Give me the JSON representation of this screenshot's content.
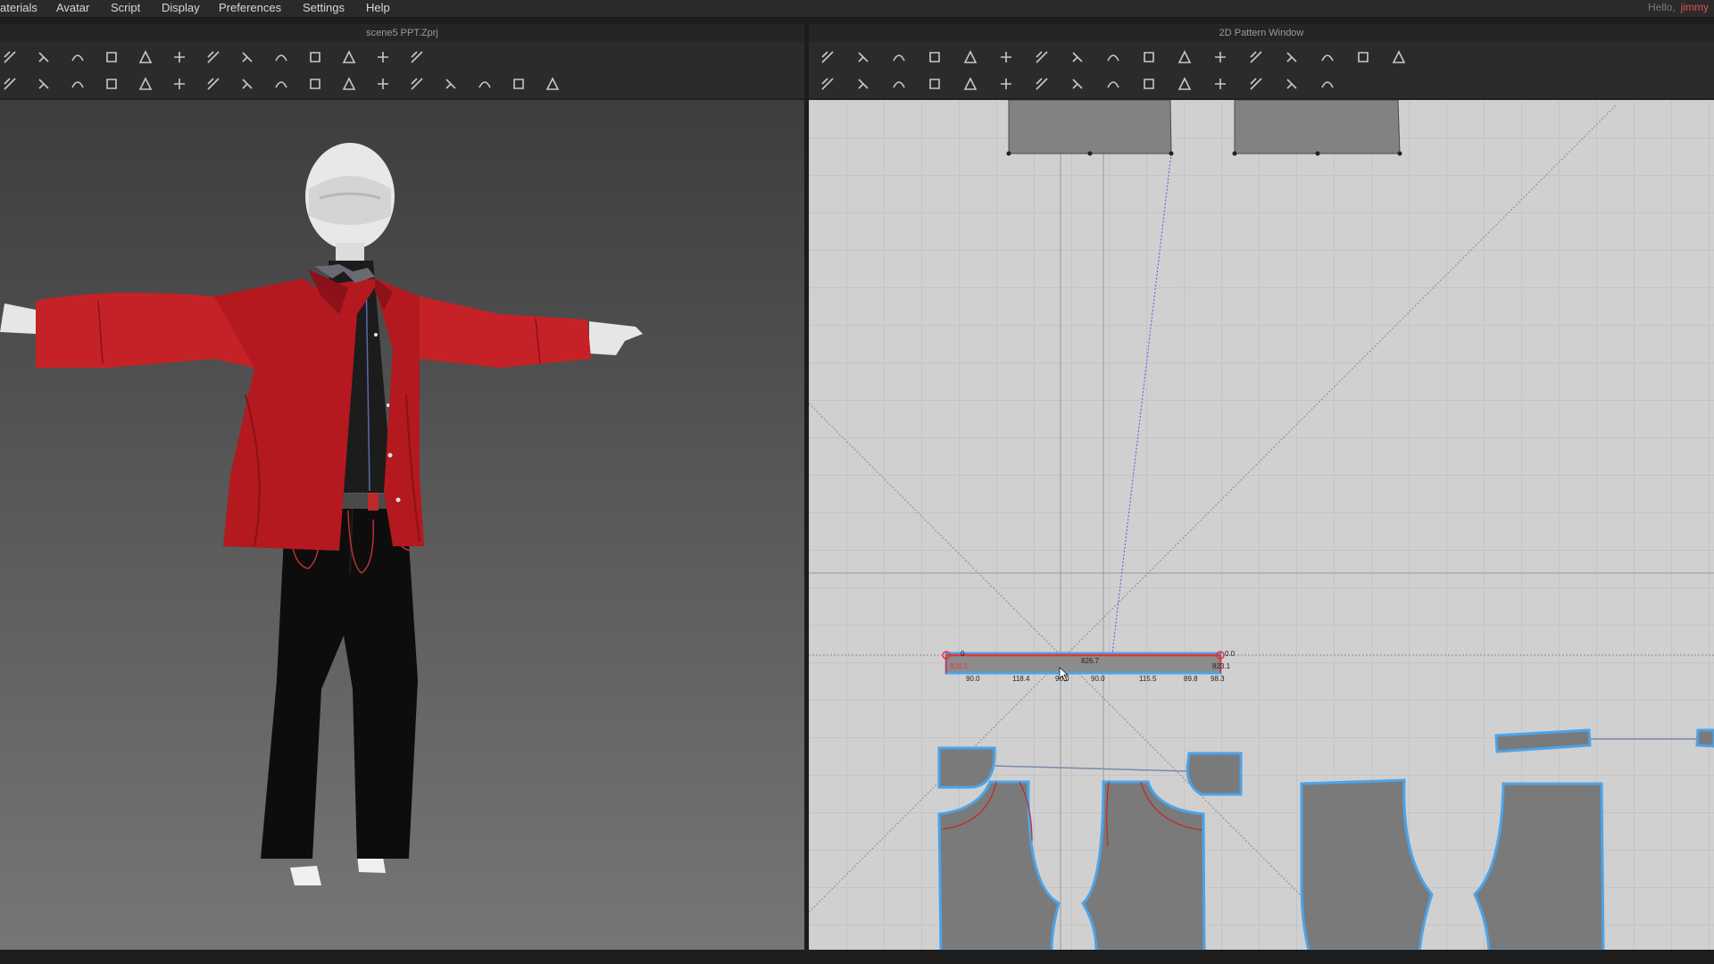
{
  "menu": {
    "items": [
      "aterials",
      "Avatar",
      "Script",
      "Display",
      "Preferences",
      "Settings",
      "Help"
    ],
    "greeting": "Hello,",
    "user": "jimmy"
  },
  "view3d": {
    "title": "scene5 PPT.Zprj",
    "toolbar_row1": [
      "sim-icon",
      "select-icon",
      "move-icon",
      "fold-icon",
      "garment-icon",
      "tack-icon",
      "pin-icon",
      "shirt-icon",
      "avatar-icon",
      "pants-icon",
      "measure-icon",
      "lasso-icon",
      "ruler-icon"
    ],
    "toolbar_row2": [
      "transform-icon",
      "stretch-icon",
      "fabric-icon",
      "steam-icon",
      "button-icon",
      "zipper-icon",
      "point-icon",
      "circle-icon",
      "line-icon",
      "lock-icon",
      "layer-icon",
      "flat-icon",
      "iron-icon",
      "tape-icon",
      "shirt-solid-icon",
      "shirt-outline-icon",
      "puckering-icon"
    ]
  },
  "view2d": {
    "title": "2D Pattern Window",
    "toolbar_row1": [
      "transform-pattern-icon",
      "edit-pattern-icon",
      "curve-icon",
      "bezier-icon",
      "add-point-icon",
      "cut-icon",
      "dart-icon",
      "polygon-icon",
      "rectangle-icon",
      "circle-icon",
      "internal-polygon-icon",
      "internal-rectangle-icon",
      "internal-circle-icon",
      "ellipse-icon",
      "trace-icon",
      "fold-icon",
      "arrange-icon"
    ],
    "toolbar_row2": [
      "segment-sew-icon",
      "free-sew-icon",
      "m-n-sew-icon",
      "check-sew-icon",
      "sewing-edit-icon",
      "iron-icon",
      "shirt-solid-icon",
      "tack-icon",
      "steam-icon",
      "button-icon",
      "buttonhole-icon",
      "topstitch-icon",
      "segment-topstitch-icon",
      "puckering-icon",
      "seam-taping-icon"
    ],
    "measurements": {
      "top": "826.7",
      "left_top": "0",
      "right_top": "0.0",
      "left_side": "826.1",
      "right_side": "823.1",
      "bottom": [
        "90.0",
        "118.4",
        "90.0",
        "90.0",
        "115.5",
        "89.8",
        "98.3"
      ]
    }
  },
  "colors": {
    "accent_red": "#e0383a",
    "seam_blue": "#4da3e8",
    "pattern_fill": "#7a7a7a",
    "jacket_red": "#b81c22"
  }
}
